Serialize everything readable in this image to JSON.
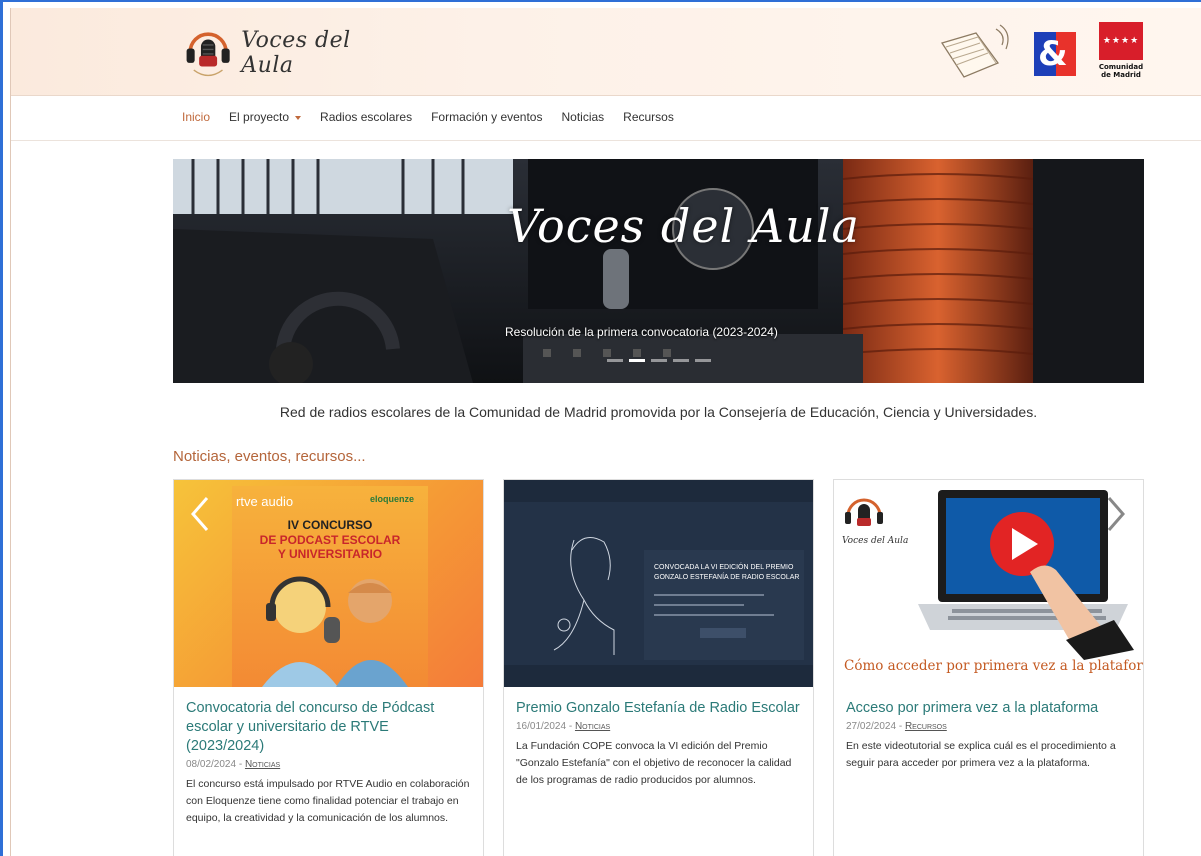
{
  "site": {
    "name": "Voces del Aula",
    "madrid_label": "Comunidad de Madrid"
  },
  "nav": {
    "items": [
      "Inicio",
      "El proyecto",
      "Radios escolares",
      "Formación y eventos",
      "Noticias",
      "Recursos"
    ]
  },
  "hero": {
    "title": "Voces del Aula",
    "caption": "Resolución de la primera convocatoria (2023-2024)"
  },
  "subtitle": "Red de radios escolares de la Comunidad de Madrid promovida por la Consejería de Educación, Ciencia y Universidades.",
  "section_title": "Noticias, eventos, recursos...",
  "cards": [
    {
      "title": "Convocatoria del concurso de Pódcast escolar y universitario de RTVE (2023/2024)",
      "date": "08/02/2024",
      "category": "Noticias",
      "description": "El concurso está impulsado por RTVE Audio en colaboración con Eloquenze tiene como finalidad potenciar el trabajo en equipo, la creatividad y la comunicación de los alumnos.",
      "img_brand_left": "rtve audio",
      "img_brand_right": "eloquenze",
      "img_heading_1": "IV CONCURSO",
      "img_heading_2": "DE PODCAST ESCOLAR",
      "img_heading_3": "Y UNIVERSITARIO"
    },
    {
      "title": "Premio Gonzalo Estefanía de Radio Escolar",
      "date": "16/01/2024",
      "category": "Noticias",
      "description": "La Fundación COPE convoca la VI edición del Premio \"Gonzalo Estefanía\" con el objetivo de reconocer la calidad de los programas de radio producidos por alumnos.",
      "img_heading_1": "CONVOCADA LA VI EDICIÓN DEL PREMIO",
      "img_heading_2": "GONZALO ESTEFANÍA DE RADIO ESCOLAR"
    },
    {
      "title": "Acceso por primera vez a la plataforma",
      "date": "27/02/2024",
      "category": "Recursos",
      "description": "En este videotutorial se explica cuál es el procedimiento a seguir para acceder por primera vez a la plataforma.",
      "img_logo": "Voces del Aula",
      "img_caption": "Cómo acceder por primera vez a la plataforma web"
    }
  ],
  "colors": {
    "accent": "#c0693c",
    "link": "#2b7a78"
  }
}
